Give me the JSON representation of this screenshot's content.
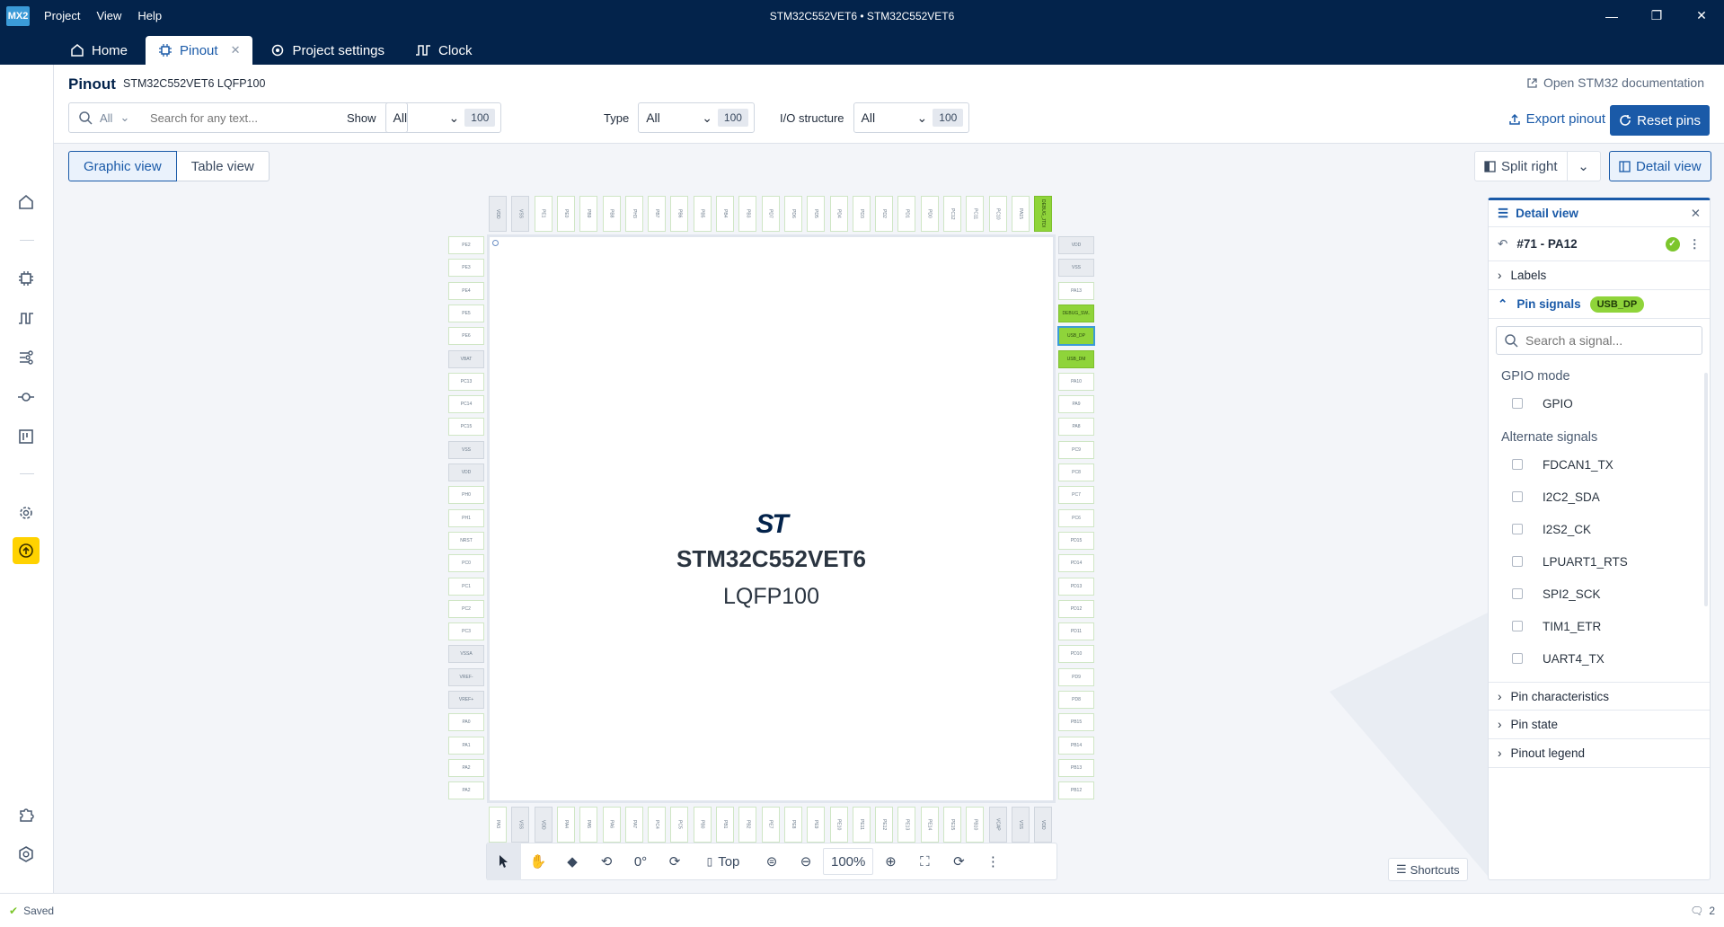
{
  "app": {
    "logo": "MX2",
    "menu": [
      "Project",
      "View",
      "Help"
    ],
    "window_title": "STM32C552VET6  •  STM32C552VET6"
  },
  "tabs": [
    {
      "label": "Home",
      "icon": "home-icon"
    },
    {
      "label": "Pinout",
      "icon": "chip-icon",
      "active": true
    },
    {
      "label": "Project settings",
      "icon": "settings-icon"
    },
    {
      "label": "Clock",
      "icon": "clock-wave-icon"
    }
  ],
  "header": {
    "title": "Pinout",
    "subtitle": "STM32C552VET6 LQFP100",
    "doc_link": "Open STM32 documentation",
    "search": {
      "scope": "All",
      "placeholder": "Search for any text..."
    },
    "filters": [
      {
        "label": "Show",
        "value": "All",
        "count": "100"
      },
      {
        "label": "Type",
        "value": "All",
        "count": "100"
      },
      {
        "label": "I/O structure",
        "value": "All",
        "count": "100"
      }
    ],
    "export_label": "Export pinout",
    "reset_label": "Reset pins"
  },
  "views": {
    "graphic": "Graphic view",
    "table": "Table view",
    "split": "Split right",
    "detail": "Detail view"
  },
  "chip": {
    "brand": "ST",
    "part": "STM32C552VET6",
    "package": "LQFP100"
  },
  "pins": {
    "top": [
      "VDD",
      "VSS",
      "PE1",
      "PE0",
      "PB9",
      "PB8",
      "PH3",
      "PB7",
      "PB6",
      "PB5",
      "PB4",
      "PB3",
      "PD7",
      "PD6",
      "PD5",
      "PD4",
      "PD3",
      "PD2",
      "PD1",
      "PD0",
      "PC12",
      "PC11",
      "PC10",
      "PA15",
      "DEBUG_JTDI"
    ],
    "right": [
      "VDD",
      "VSS",
      "PA13",
      "DEBUG_SW..",
      "USB_DP",
      "USB_DM",
      "PA10",
      "PA9",
      "PA8",
      "PC9",
      "PC8",
      "PC7",
      "PC6",
      "PD15",
      "PD14",
      "PD13",
      "PD12",
      "PD11",
      "PD10",
      "PD9",
      "PD8",
      "PB15",
      "PB14",
      "PB13",
      "PB12"
    ],
    "bottom": [
      "PA3",
      "VSS",
      "VDD",
      "PA4",
      "PA5",
      "PA6",
      "PA7",
      "PC4",
      "PC5",
      "PB0",
      "PB1",
      "PB2",
      "PE7",
      "PE8",
      "PE9",
      "PE10",
      "PE11",
      "PE12",
      "PE13",
      "PE14",
      "PE15",
      "PB10",
      "VCAP",
      "VSS",
      "VDD"
    ],
    "left": [
      "PE2",
      "PE3",
      "PE4",
      "PE5",
      "PE6",
      "VBAT",
      "PC13",
      "PC14",
      "PC15",
      "VSS",
      "VDD",
      "PH0",
      "PH1",
      "NRST",
      "PC0",
      "PC1",
      "PC2",
      "PC3",
      "VSSA",
      "VREF-",
      "VREF+",
      "PA0",
      "PA1",
      "PA2",
      "PA2"
    ]
  },
  "toolbar": {
    "rotation": "0°",
    "side": "Top",
    "zoom": "100%",
    "shortcuts": "Shortcuts"
  },
  "detail": {
    "title": "Detail view",
    "pin": "#71 - PA12",
    "sections": {
      "labels": "Labels",
      "pin_signals": "Pin signals",
      "signal_badge": "USB_DP",
      "characteristics": "Pin characteristics",
      "state": "Pin state",
      "legend": "Pinout legend"
    },
    "signal_search_placeholder": "Search a signal...",
    "gpio_mode_label": "GPIO mode",
    "gpio_item": "GPIO",
    "alternate_label": "Alternate signals",
    "alternate": [
      "FDCAN1_TX",
      "I2C2_SDA",
      "I2S2_CK",
      "LPUART1_RTS",
      "SPI2_SCK",
      "TIM1_ETR",
      "UART4_TX"
    ]
  },
  "status": {
    "saved": "Saved",
    "notifications": "2"
  }
}
